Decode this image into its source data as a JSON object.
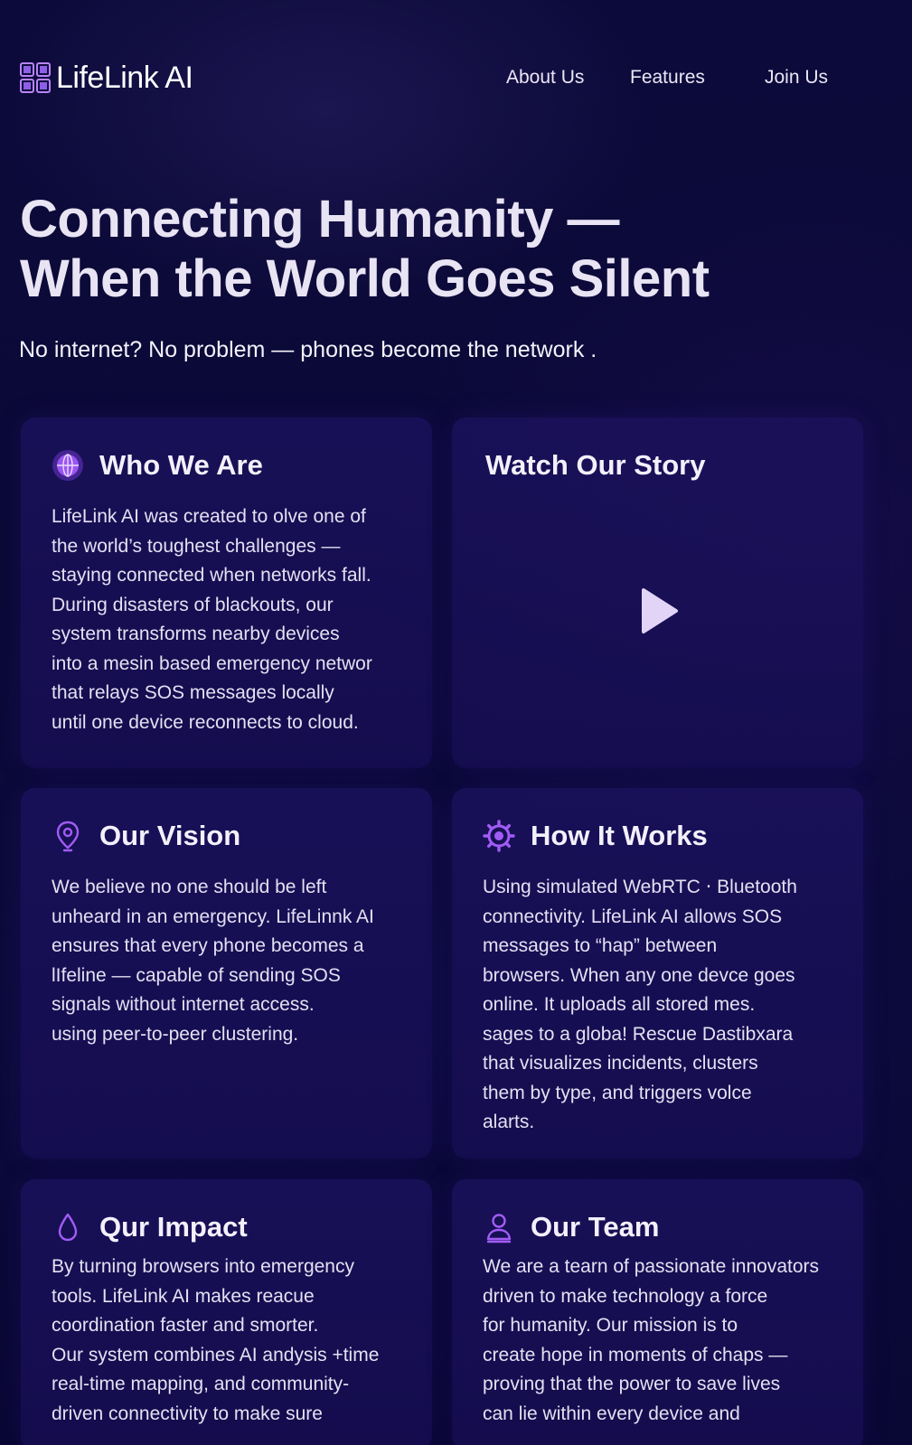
{
  "brand": {
    "name": "LifeLink AI",
    "logo_icon": "grid-logo-icon",
    "accent": "#a15cf5"
  },
  "nav": {
    "about": "About Us",
    "features": "Features",
    "join": "Join Us"
  },
  "hero": {
    "title_line1": "Connecting Humanity —",
    "title_line2": "When the World Goes Silent",
    "subtitle": "No internet? No problem — phones become the network ."
  },
  "cards": {
    "who": {
      "icon": "globe-icon",
      "title": "Who We Are",
      "lines": [
        "LifeLink AI was created to olve one of",
        "the world’s toughest challenges —",
        "staying connected when networks fall.",
        "During disasters of blackouts, our",
        "system transforms nearby devices",
        "into a mesin based emergency networ",
        "that relays SOS messages locally",
        "until one device reconnects to cloud."
      ]
    },
    "story": {
      "title": "Watch Our Story",
      "icon": "play-icon"
    },
    "vision": {
      "icon": "location-pin-icon",
      "title": "Our Vision",
      "lines": [
        "We believe no one should be left",
        "unheard in an emergency. LifeLinnk AI",
        "ensures that every phone becomes a",
        "lIfeline — capable of sending SOS",
        "signals without internet access.",
        "using peer-to-peer clustering."
      ]
    },
    "how": {
      "icon": "gear-icon",
      "title": "How It Works",
      "lines": [
        "Using simulated WebRTC ⋅ Bluetooth",
        "connectivity. LifeLink AI allows SOS",
        "messages to “hap” between",
        "browsers. When any one devce goes",
        "online. It uploads all stored mes.",
        "sages to a globa! Rescue Dastibxara",
        "that visualizes incidents, clusters",
        "them by type, and triggers volce",
        "alarts."
      ]
    },
    "impact": {
      "icon": "droplet-icon",
      "title": "Qur Impact",
      "lines": [
        "By turning browsers into emergency",
        "tools. LifeLink AI makes reacue",
        "coordination faster and smorter.",
        "Our system combines AI andysis +time",
        "real-time mapping, and community-",
        "driven connectivity to make sure"
      ]
    },
    "team": {
      "icon": "user-icon",
      "title": "Our Team",
      "lines": [
        "We are a tearn of passionate innovators",
        "driven to make technology a force",
        "for humanity. Our mission is to",
        "create hope in moments of chaps —",
        "proving that the power to save lives",
        "can lie within every device and"
      ]
    }
  }
}
